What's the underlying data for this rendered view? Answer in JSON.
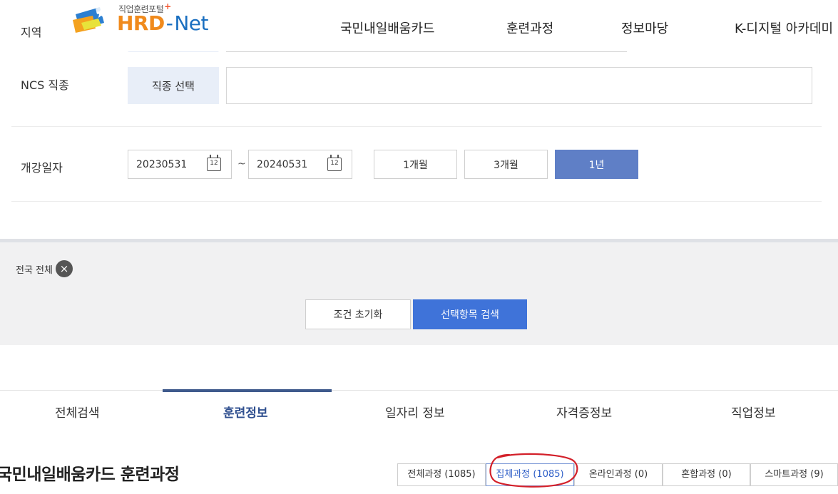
{
  "header": {
    "region_label": "지역",
    "logo": {
      "subtitle": "직업훈련포털",
      "plus": "+",
      "brand_hrd": "HRD",
      "brand_dash": "-",
      "brand_net": "Net"
    },
    "nav": [
      {
        "label": "국민내일배움카드"
      },
      {
        "label": "훈련과정"
      },
      {
        "label": "정보마당"
      },
      {
        "label": "K-디지털 아카데미"
      }
    ]
  },
  "filters": {
    "ncs": {
      "label": "NCS 직종",
      "button": "직종 선택",
      "value": ""
    },
    "start_date": {
      "label": "개강일자",
      "from": "20230531",
      "to": "20240531",
      "separator": "~",
      "calendar_icon_text": "12",
      "periods": [
        {
          "label": "1개월",
          "active": false
        },
        {
          "label": "3개월",
          "active": false
        },
        {
          "label": "1년",
          "active": true
        }
      ]
    }
  },
  "selection": {
    "chip": "전국 전체",
    "chip_remove": "×",
    "reset_button": "조건 초기화",
    "search_button": "선택항목 검색"
  },
  "main_tabs": [
    {
      "label": "전체검색",
      "active": false
    },
    {
      "label": "훈련정보",
      "active": true
    },
    {
      "label": "일자리 정보",
      "active": false
    },
    {
      "label": "자격증정보",
      "active": false
    },
    {
      "label": "직업정보",
      "active": false
    }
  ],
  "section": {
    "title": "국민내일배움카드 훈련과정",
    "subtabs": [
      {
        "label": "전체과정 (1085)",
        "active": false
      },
      {
        "label": "집체과정 (1085)",
        "active": true
      },
      {
        "label": "온라인과정 (0)",
        "active": false
      },
      {
        "label": "혼합과정 (0)",
        "active": false
      },
      {
        "label": "스마트과정 (9)",
        "active": false
      }
    ]
  },
  "colors": {
    "accent_blue": "#3f73d9",
    "active_period": "#5f7fc6",
    "tab_indicator": "#3f5a8c",
    "annotation_red": "#d3202a",
    "logo_orange": "#f08a1c",
    "logo_blue": "#1a6fc0"
  }
}
